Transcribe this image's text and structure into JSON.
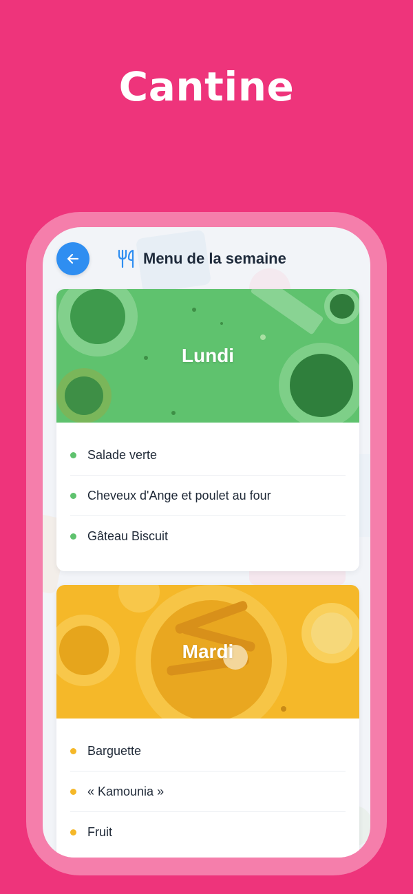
{
  "hero": {
    "title": "Cantine"
  },
  "header": {
    "title": "Menu de la semaine",
    "back_icon": "arrow-left-icon",
    "title_icon": "cutlery-icon"
  },
  "colors": {
    "background": "#EE347B",
    "frame": "#F57EAB",
    "accent": "#2F8EF1",
    "monday": "#5FC26E",
    "tuesday": "#F5B829"
  },
  "days": [
    {
      "name": "Lundi",
      "color": "#5FC26E",
      "dishes": [
        "Salade verte",
        "Cheveux d'Ange et poulet au four",
        "Gâteau Biscuit"
      ]
    },
    {
      "name": "Mardi",
      "color": "#F5B829",
      "dishes": [
        "Barguette",
        "« Kamounia »",
        "Fruit"
      ]
    }
  ]
}
